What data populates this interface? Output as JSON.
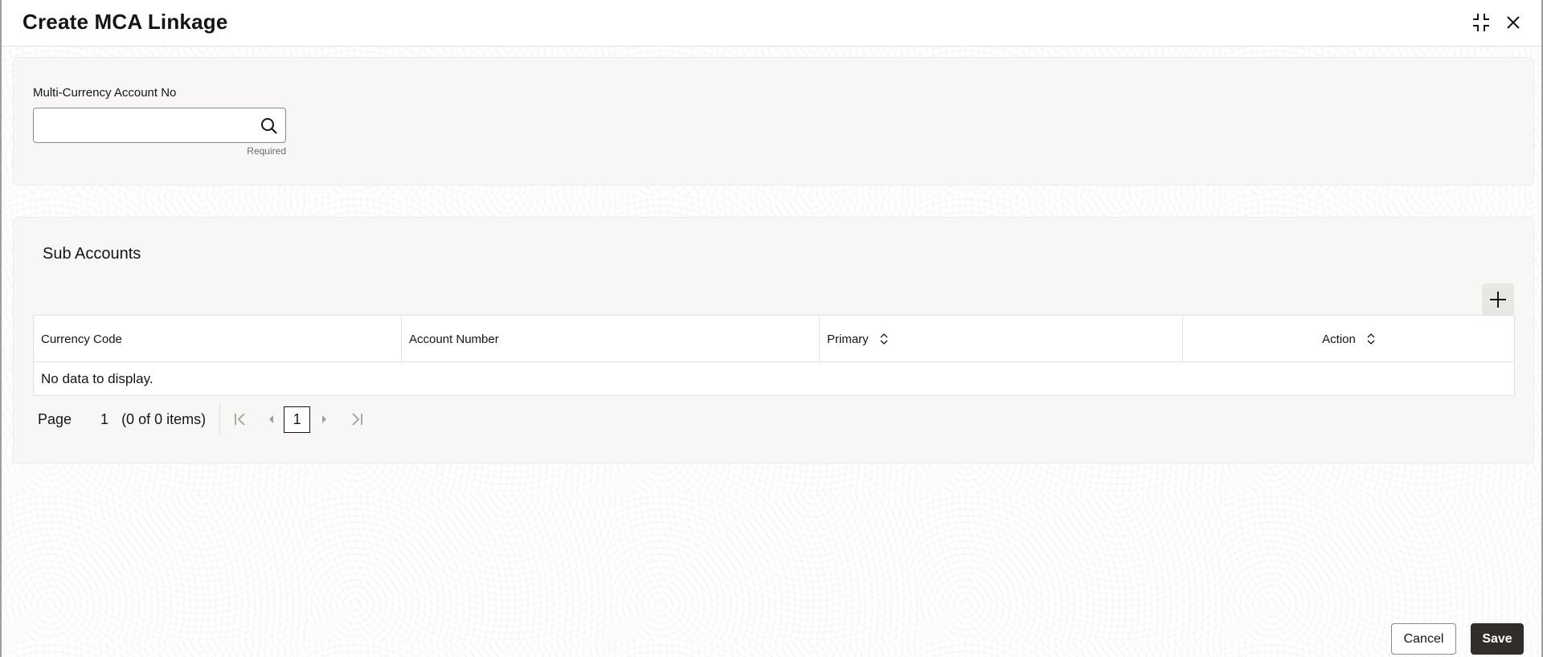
{
  "dialog": {
    "title": "Create MCA Linkage",
    "minimize_icon": "minimize-icon",
    "close_icon": "close-icon"
  },
  "account_field": {
    "label": "Multi-Currency Account No",
    "value": "",
    "placeholder": "",
    "helper": "Required",
    "icon": "search-icon"
  },
  "sub_accounts": {
    "title": "Sub Accounts",
    "add_icon": "plus-icon",
    "columns": [
      {
        "label": "Currency Code",
        "sortable": false
      },
      {
        "label": "Account Number",
        "sortable": false
      },
      {
        "label": "Primary",
        "sortable": true
      },
      {
        "label": "Action",
        "sortable": true
      }
    ],
    "rows": [],
    "empty_text": "No data to display."
  },
  "pagination": {
    "page_label": "Page",
    "page_value": "1",
    "items_text": "(0 of 0 items)",
    "current_page": "1"
  },
  "footer": {
    "cancel_label": "Cancel",
    "save_label": "Save"
  },
  "colors": {
    "primary_button": "#312d2a",
    "panel_bg": "#f8f7f6",
    "text": "#161513"
  }
}
